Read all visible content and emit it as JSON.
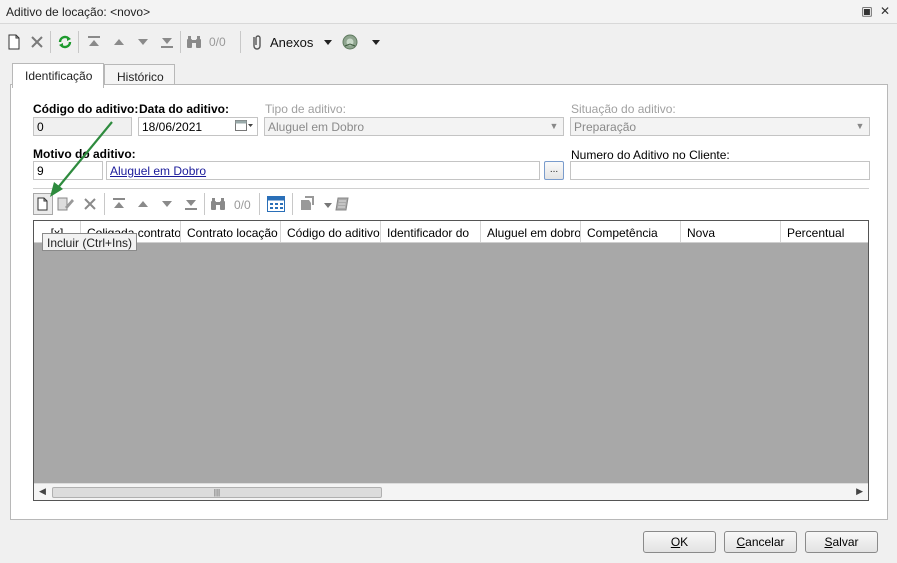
{
  "window": {
    "title": "Aditivo de locação: <novo>",
    "restore_glyph": "▣",
    "close_glyph": "✕"
  },
  "toolbar": {
    "counter": "0/0",
    "anexos_label": "Anexos",
    "icons": [
      "new-icon",
      "delete-icon",
      "refresh-icon",
      "first-icon",
      "previous-icon",
      "next-icon",
      "last-icon",
      "find-icon",
      "attach-icon",
      "process-icon"
    ]
  },
  "tabs": [
    {
      "label": "Identificação",
      "active": true
    },
    {
      "label": "Histórico",
      "active": false
    }
  ],
  "form": {
    "codigo_label": "Código do aditivo:",
    "codigo_value": "0",
    "data_label": "Data do aditivo:",
    "data_value": "18/06/2021",
    "tipo_label": "Tipo de aditivo:",
    "tipo_value": "Aluguel em Dobro",
    "situacao_label": "Situação do aditivo:",
    "situacao_value": "Preparação",
    "motivo_label": "Motivo do aditivo:",
    "motivo_code": "9",
    "motivo_desc": "Aluguel em Dobro",
    "ellipsis_label": "...",
    "numero_label": "Numero do Aditivo no Cliente:",
    "numero_value": ""
  },
  "grid_toolbar": {
    "counter": "0/0"
  },
  "tooltip": "Incluir (Ctrl+Ins)",
  "grid": {
    "columns": [
      "[x]",
      "Coligada contrato",
      "Contrato locação",
      "Código do aditivo",
      "Identificador do",
      "Aluguel em dobro",
      "Competência",
      "Nova",
      "Percentual"
    ],
    "rows": []
  },
  "buttons": {
    "ok_mnemonic": "O",
    "ok_rest": "K",
    "cancel_mnemonic": "C",
    "cancel_rest": "ancelar",
    "save_mnemonic": "S",
    "save_rest": "alvar"
  },
  "colors": {
    "annotation_arrow": "#2e8b3e",
    "grid_background": "#a8a8a8",
    "link": "#1a1a9a"
  }
}
